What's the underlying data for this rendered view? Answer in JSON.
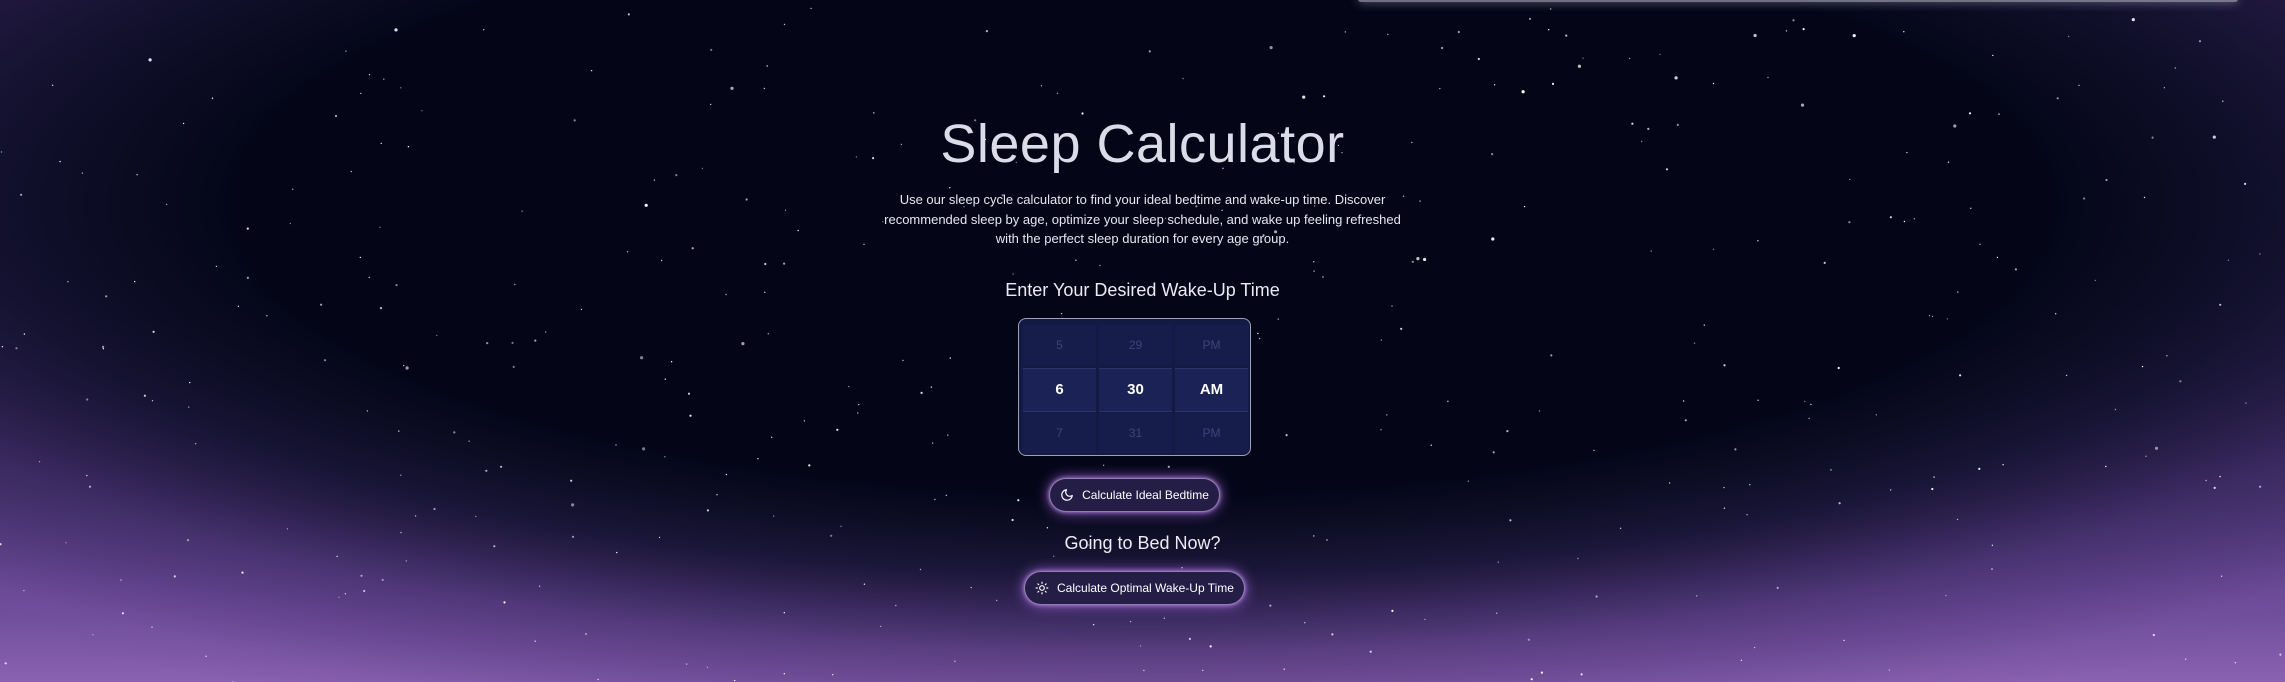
{
  "header": {
    "title": "Sleep Calculator",
    "description": "Use our sleep cycle calculator to find your ideal bedtime and wake-up time. Discover recommended sleep by age, optimize your sleep schedule, and wake up feeling refreshed with the perfect sleep duration for every age group."
  },
  "wake_section": {
    "heading": "Enter Your Desired Wake-Up Time",
    "picker": {
      "hour": {
        "prev": "5",
        "current": "6",
        "next": "7"
      },
      "minute": {
        "prev": "29",
        "current": "30",
        "next": "31"
      },
      "period": {
        "prev": "PM",
        "current": "AM",
        "next": "PM"
      }
    },
    "button_label": "Calculate Ideal Bedtime",
    "button_icon": "moon-icon"
  },
  "bed_now_section": {
    "heading": "Going to Bed Now?",
    "button_label": "Calculate Optimal Wake-Up Time",
    "button_icon": "sun-icon"
  },
  "colors": {
    "background_top": "#040618",
    "background_bottom": "#8b62b2",
    "picker_bg": "#131a44",
    "button_glow": "#be78ff"
  }
}
